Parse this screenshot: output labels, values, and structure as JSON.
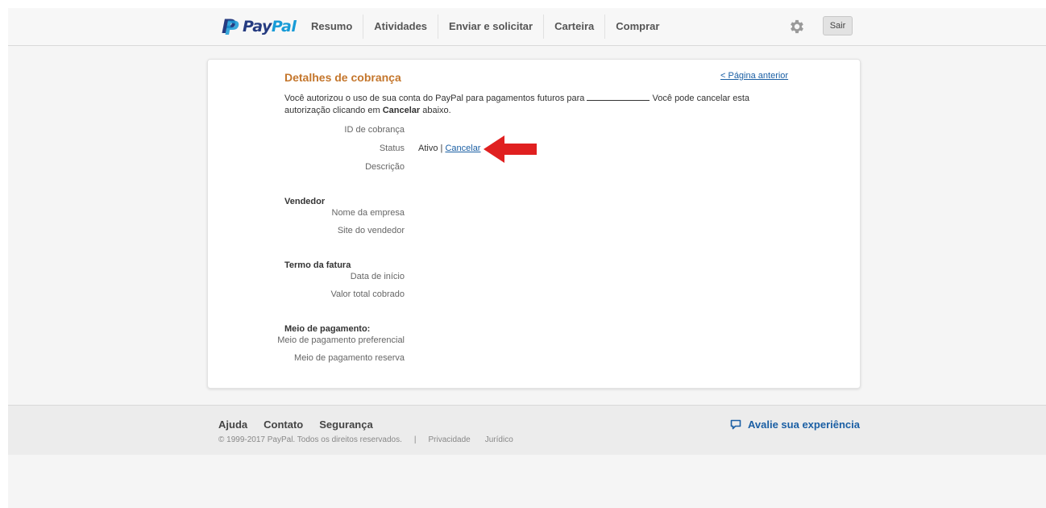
{
  "header": {
    "logo_text_pay": "Pay",
    "logo_text_pal": "Pal",
    "nav": [
      "Resumo",
      "Atividades",
      "Enviar e solicitar",
      "Carteira",
      "Comprar"
    ],
    "settings_icon": "gear-icon",
    "logout_label": "Sair"
  },
  "card": {
    "title": "Detalhes de cobrança",
    "back_link": "< Página anterior",
    "intro_part1": "Você autorizou o uso de sua conta do PayPal para pagamentos futuros para",
    "intro_part2": "Você pode cancelar esta autorização clicando em",
    "intro_bold": "Cancelar",
    "intro_part3": "abaixo.",
    "fields": {
      "billing_id": "ID de cobrança",
      "status": "Status",
      "description": "Descrição"
    },
    "status_value": "Ativo",
    "status_sep": "|",
    "cancel_link": "Cancelar",
    "seller": {
      "title": "Vendedor",
      "company_name": "Nome da empresa",
      "seller_site": "Site do vendedor"
    },
    "invoice_term": {
      "title": "Termo da fatura",
      "start_date": "Data de início",
      "total_charged": "Valor total cobrado"
    },
    "payment_method": {
      "title": "Meio de pagamento:",
      "preferred": "Meio de pagamento preferencial",
      "backup": "Meio de pagamento reserva"
    },
    "arrow_color": "#e02020"
  },
  "footer": {
    "links": [
      "Ajuda",
      "Contato",
      "Segurança"
    ],
    "copyright": "© 1999-2017 PayPal. Todos os direitos reservados.",
    "separator": "|",
    "privacy": "Privacidade",
    "legal": "Jurídico",
    "feedback": "Avalie sua experiência"
  }
}
